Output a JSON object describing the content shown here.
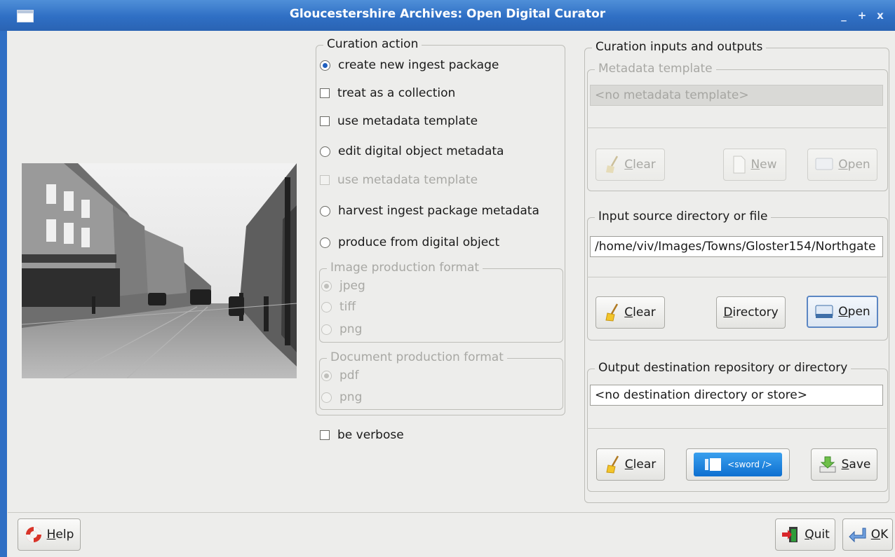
{
  "window": {
    "title": "Gloucestershire Archives: Open Digital Curator",
    "controls": [
      "_",
      "+",
      "x"
    ]
  },
  "curation_action": {
    "legend": "Curation action",
    "create_new_ingest_package": "create new ingest package",
    "treat_as_collection": "treat as a collection",
    "use_metadata_template_1": "use metadata template",
    "edit_digital_object_metadata": "edit digital object metadata",
    "use_metadata_template_2": "use metadata template",
    "harvest_ingest_package_metadata": "harvest ingest package metadata",
    "produce_from_digital_object": "produce from digital object",
    "image_format": {
      "legend": "Image production format",
      "options": [
        "jpeg",
        "tiff",
        "png"
      ],
      "selected": "jpeg"
    },
    "document_format": {
      "legend": "Document production format",
      "options": [
        "pdf",
        "png"
      ],
      "selected": "pdf"
    },
    "be_verbose": "be verbose"
  },
  "io": {
    "legend": "Curation inputs and outputs",
    "metadata_template": {
      "legend": "Metadata template",
      "value": "<no metadata template>",
      "clear": "Clear",
      "new": "New",
      "open": "Open"
    },
    "input_source": {
      "legend": "Input source directory or file",
      "value": "/home/viv/Images/Towns/Gloster154/Northgate",
      "clear": "Clear",
      "directory": "Directory",
      "open": "Open"
    },
    "output_destination": {
      "legend": "Output destination repository or directory",
      "value": "<no destination directory or store>",
      "clear": "Clear",
      "sword": "<sword />",
      "save": "Save"
    }
  },
  "footer": {
    "help": "Help",
    "quit": "Quit",
    "ok": "OK"
  },
  "colors": {
    "titlebar": "#2f6fc4",
    "accent": "#1f5fbf",
    "sword": "#1a7fe0"
  }
}
